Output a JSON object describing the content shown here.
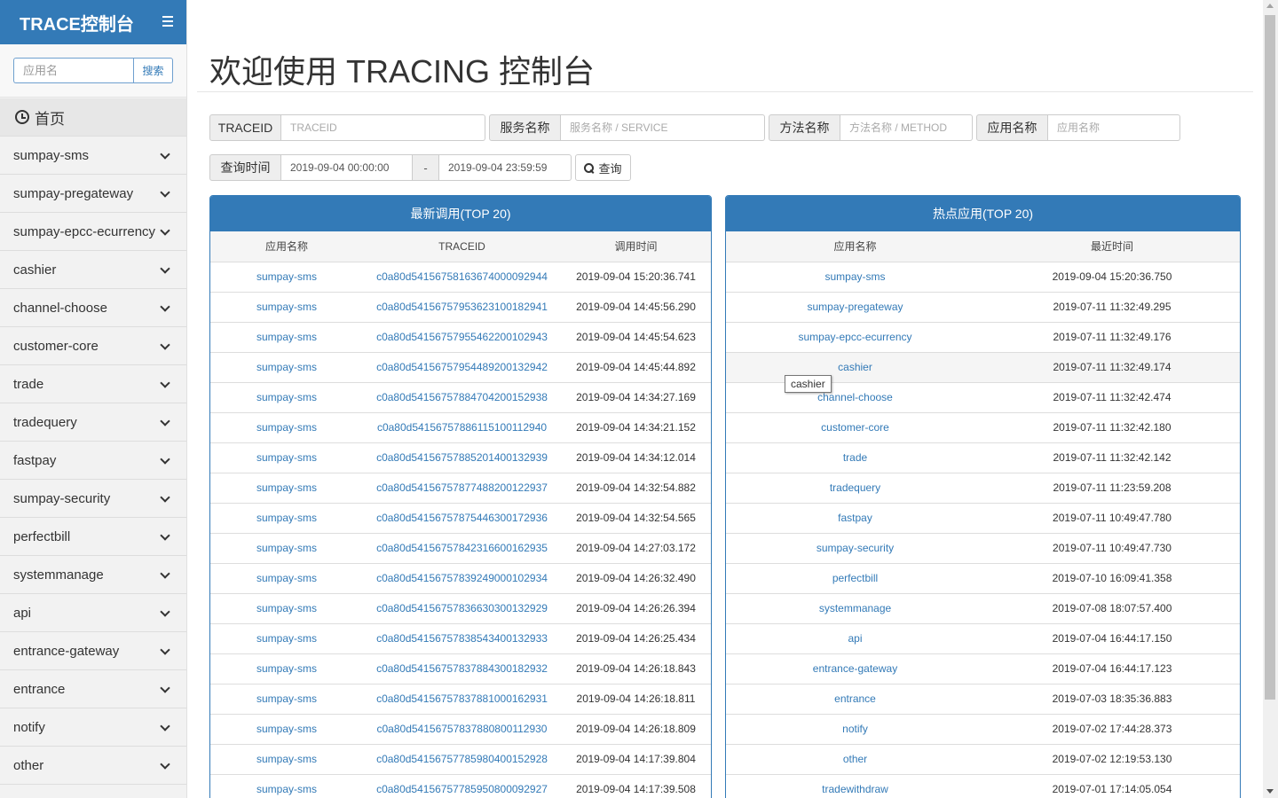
{
  "sidebar": {
    "brand": "TRACE控制台",
    "search_placeholder": "应用名",
    "search_button": "搜索",
    "home": "首页",
    "items": [
      "sumpay-sms",
      "sumpay-pregateway",
      "sumpay-epcc-ecurrency",
      "cashier",
      "channel-choose",
      "customer-core",
      "trade",
      "tradequery",
      "fastpay",
      "sumpay-security",
      "perfectbill",
      "systemmanage",
      "api",
      "entrance-gateway",
      "entrance",
      "notify",
      "other"
    ]
  },
  "main": {
    "title": "欢迎使用 TRACING 控制台",
    "filters": {
      "traceid_label": "TRACEID",
      "traceid_placeholder": "TRACEID",
      "service_label": "服务名称",
      "service_placeholder": "服务名称 / SERVICE",
      "method_label": "方法名称",
      "method_placeholder": "方法名称 / METHOD",
      "app_label": "应用名称",
      "app_placeholder": "应用名称",
      "time_label": "查询时间",
      "time_start": "2019-09-04 00:00:00",
      "time_sep": "-",
      "time_end": "2019-09-04 23:59:59",
      "query_button": "查询"
    },
    "latest": {
      "heading": "最新调用(TOP 20)",
      "columns": [
        "应用名称",
        "TRACEID",
        "调用时间"
      ],
      "rows": [
        [
          "sumpay-sms",
          "c0a80d5415675816367400009294​4",
          "2019-09-04 15:20:36.741"
        ],
        [
          "sumpay-sms",
          "c0a80d541567579536231001829​41",
          "2019-09-04 14:45:56.290"
        ],
        [
          "sumpay-sms",
          "c0a80d541567579554622001029​43",
          "2019-09-04 14:45:54.623"
        ],
        [
          "sumpay-sms",
          "c0a80d541567579544892001329​42",
          "2019-09-04 14:45:44.892"
        ],
        [
          "sumpay-sms",
          "c0a80d541567578847042001529​38",
          "2019-09-04 14:34:27.169"
        ],
        [
          "sumpay-sms",
          "c0a80d541567578861151001129​40",
          "2019-09-04 14:34:21.152"
        ],
        [
          "sumpay-sms",
          "c0a80d541567578852014001329​39",
          "2019-09-04 14:34:12.014"
        ],
        [
          "sumpay-sms",
          "c0a80d541567578774882001229​37",
          "2019-09-04 14:32:54.882"
        ],
        [
          "sumpay-sms",
          "c0a80d541567578754463001729​36",
          "2019-09-04 14:32:54.565"
        ],
        [
          "sumpay-sms",
          "c0a80d541567578423166001629​35",
          "2019-09-04 14:27:03.172"
        ],
        [
          "sumpay-sms",
          "c0a80d541567578392490001029​34",
          "2019-09-04 14:26:32.490"
        ],
        [
          "sumpay-sms",
          "c0a80d541567578366303001329​29",
          "2019-09-04 14:26:26.394"
        ],
        [
          "sumpay-sms",
          "c0a80d541567578385434001329​33",
          "2019-09-04 14:26:25.434"
        ],
        [
          "sumpay-sms",
          "c0a80d541567578378843001829​32",
          "2019-09-04 14:26:18.843"
        ],
        [
          "sumpay-sms",
          "c0a80d541567578378810001629​31",
          "2019-09-04 14:26:18.811"
        ],
        [
          "sumpay-sms",
          "c0a80d541567578378808001129​30",
          "2019-09-04 14:26:18.809"
        ],
        [
          "sumpay-sms",
          "c0a80d541567577859804001529​28",
          "2019-09-04 14:17:39.804"
        ],
        [
          "sumpay-sms",
          "c0a80d541567577859508000929​27",
          "2019-09-04 14:17:39.508"
        ]
      ]
    },
    "hot": {
      "heading": "热点应用(TOP 20)",
      "columns": [
        "应用名称",
        "最近时间"
      ],
      "rows": [
        [
          "sumpay-sms",
          "2019-09-04 15:20:36.750"
        ],
        [
          "sumpay-pregateway",
          "2019-07-11 11:32:49.295"
        ],
        [
          "sumpay-epcc-ecurrency",
          "2019-07-11 11:32:49.176"
        ],
        [
          "cashier",
          "2019-07-11 11:32:49.174"
        ],
        [
          "channel-choose",
          "2019-07-11 11:32:42.474"
        ],
        [
          "customer-core",
          "2019-07-11 11:32:42.180"
        ],
        [
          "trade",
          "2019-07-11 11:32:42.142"
        ],
        [
          "tradequery",
          "2019-07-11 11:23:59.208"
        ],
        [
          "fastpay",
          "2019-07-11 10:49:47.780"
        ],
        [
          "sumpay-security",
          "2019-07-11 10:49:47.730"
        ],
        [
          "perfectbill",
          "2019-07-10 16:09:41.358"
        ],
        [
          "systemmanage",
          "2019-07-08 18:07:57.400"
        ],
        [
          "api",
          "2019-07-04 16:44:17.150"
        ],
        [
          "entrance-gateway",
          "2019-07-04 16:44:17.123"
        ],
        [
          "entrance",
          "2019-07-03 18:35:36.883"
        ],
        [
          "notify",
          "2019-07-02 17:44:28.373"
        ],
        [
          "other",
          "2019-07-02 12:19:53.130"
        ],
        [
          "tradewithdraw",
          "2019-07-01 17:14:05.054"
        ]
      ],
      "hover_row": 3
    },
    "tooltip": "cashier"
  },
  "colors": {
    "primary": "#337ab7",
    "link": "#337ab7"
  }
}
